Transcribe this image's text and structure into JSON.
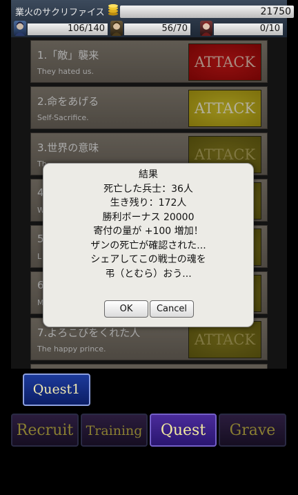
{
  "header": {
    "title": "業火のサクリファイス",
    "gold": "21750",
    "stats": [
      {
        "value": "106/140"
      },
      {
        "value": "56/70"
      },
      {
        "value": "0/10"
      }
    ]
  },
  "quests": [
    {
      "title": "1.「敵」襲来",
      "subtitle": "They hated us.",
      "attack": "ATTACK",
      "style": "red"
    },
    {
      "title": "2.命をあげる",
      "subtitle": "Self-Sacrifice.",
      "attack": "ATTACK",
      "style": "yellow"
    },
    {
      "title": "3.世界の意味",
      "subtitle": "Th",
      "attack": "ATTACK",
      "style": "dim"
    },
    {
      "title": "4",
      "subtitle": "W",
      "attack": "",
      "style": "dim"
    },
    {
      "title": "5",
      "subtitle": "L",
      "attack": "",
      "style": "dim"
    },
    {
      "title": "6",
      "subtitle": "M",
      "attack": "",
      "style": "dim"
    },
    {
      "title": "7.よろこびをくれた人",
      "subtitle": "The happy prince.",
      "attack": "ATTACK",
      "style": "dim"
    }
  ],
  "dialog": {
    "title": "結果",
    "lines": [
      "死亡した兵士：36人",
      "生き残り：172人",
      "勝利ボーナス 20000",
      "寄付の量が +100 増加！",
      "ザンの死亡が確認された...",
      "シェアしてこの戦士の魂を",
      "弔（とむら）おう..."
    ],
    "ok_label": "OK",
    "cancel_label": "Cancel"
  },
  "quest_tab": {
    "label": "Quest1"
  },
  "nav": {
    "recruit": "Recruit",
    "training": "Training",
    "quest": "Quest",
    "grave": "Grave",
    "active": "quest"
  }
}
